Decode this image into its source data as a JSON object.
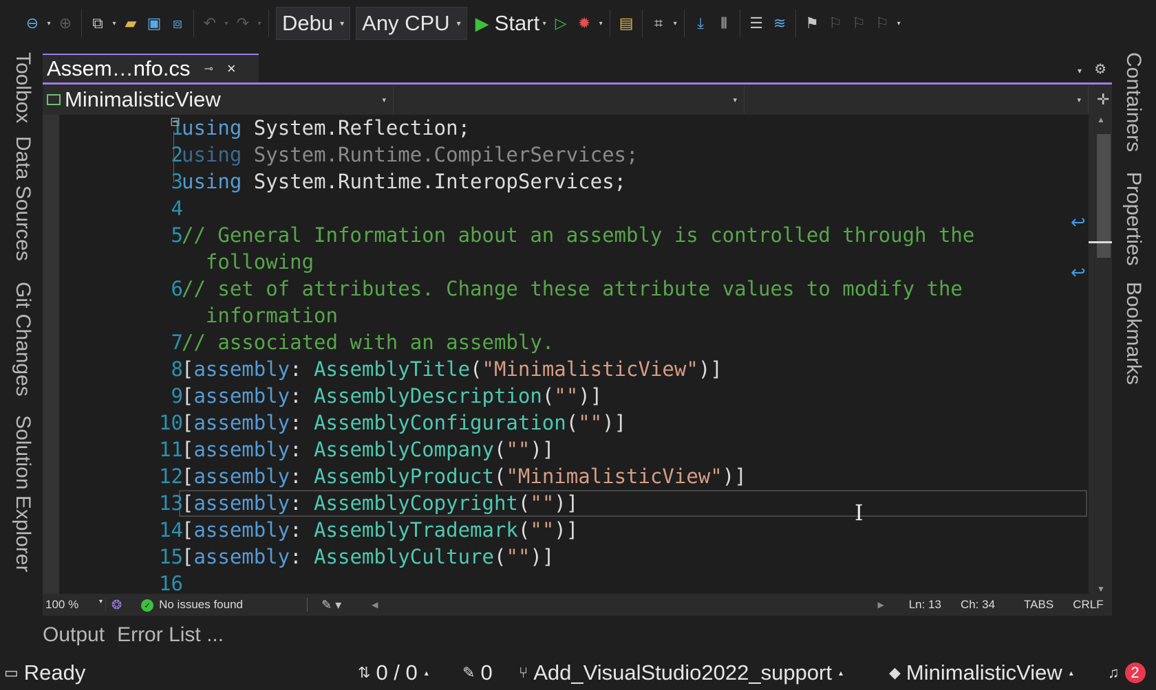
{
  "toolbar": {
    "config_label": "Debu",
    "platform_label": "Any CPU",
    "start_label": "Start"
  },
  "left_rail": [
    "Toolbox",
    "Data Sources",
    "Git Changes",
    "Solution Explorer"
  ],
  "right_rail": [
    "Containers",
    "Properties",
    "Bookmarks"
  ],
  "doc_tab": {
    "title": "Assem…nfo.cs"
  },
  "navbar": {
    "class_label": "MinimalisticView"
  },
  "editor": {
    "lines": [
      {
        "n": "1",
        "parts": [
          [
            "kw",
            "using"
          ],
          [
            "txt",
            " System.Reflection;"
          ]
        ]
      },
      {
        "n": "2",
        "parts": [
          [
            "kw-dim",
            "using"
          ],
          [
            "txt-dim",
            " System.Runtime.CompilerServices;"
          ]
        ]
      },
      {
        "n": "3",
        "parts": [
          [
            "kw",
            "using"
          ],
          [
            "txt",
            " System.Runtime.InteropServices;"
          ]
        ]
      },
      {
        "n": "4",
        "parts": []
      },
      {
        "n": "5",
        "parts": [
          [
            "cmt",
            "// General Information about an assembly is controlled through the"
          ]
        ]
      },
      {
        "n": "",
        "parts": [
          [
            "cmt",
            "  following"
          ]
        ]
      },
      {
        "n": "6",
        "parts": [
          [
            "cmt",
            "// set of attributes. Change these attribute values to modify the"
          ]
        ]
      },
      {
        "n": "",
        "parts": [
          [
            "cmt",
            "  information"
          ]
        ]
      },
      {
        "n": "7",
        "parts": [
          [
            "cmt",
            "// associated with an assembly."
          ]
        ]
      },
      {
        "n": "8",
        "parts": [
          [
            "txt",
            "["
          ],
          [
            "attr-kw",
            "assembly"
          ],
          [
            "txt",
            ": "
          ],
          [
            "typ",
            "AssemblyTitle"
          ],
          [
            "txt",
            "("
          ],
          [
            "str",
            "\"MinimalisticView\""
          ],
          [
            "txt",
            ")]"
          ]
        ]
      },
      {
        "n": "9",
        "parts": [
          [
            "txt",
            "["
          ],
          [
            "attr-kw",
            "assembly"
          ],
          [
            "txt",
            ": "
          ],
          [
            "typ",
            "AssemblyDescription"
          ],
          [
            "txt",
            "("
          ],
          [
            "str",
            "\"\""
          ],
          [
            "txt",
            ")]"
          ]
        ]
      },
      {
        "n": "10",
        "parts": [
          [
            "txt",
            "["
          ],
          [
            "attr-kw",
            "assembly"
          ],
          [
            "txt",
            ": "
          ],
          [
            "typ",
            "AssemblyConfiguration"
          ],
          [
            "txt",
            "("
          ],
          [
            "str",
            "\"\""
          ],
          [
            "txt",
            ")]"
          ]
        ]
      },
      {
        "n": "11",
        "parts": [
          [
            "txt",
            "["
          ],
          [
            "attr-kw",
            "assembly"
          ],
          [
            "txt",
            ": "
          ],
          [
            "typ",
            "AssemblyCompany"
          ],
          [
            "txt",
            "("
          ],
          [
            "str",
            "\"\""
          ],
          [
            "txt",
            ")]"
          ]
        ]
      },
      {
        "n": "12",
        "parts": [
          [
            "txt",
            "["
          ],
          [
            "attr-kw",
            "assembly"
          ],
          [
            "txt",
            ": "
          ],
          [
            "typ",
            "AssemblyProduct"
          ],
          [
            "txt",
            "("
          ],
          [
            "str",
            "\"MinimalisticView\""
          ],
          [
            "txt",
            ")]"
          ]
        ]
      },
      {
        "n": "13",
        "parts": [
          [
            "txt",
            "["
          ],
          [
            "attr-kw",
            "assembly"
          ],
          [
            "txt",
            ": "
          ],
          [
            "typ",
            "AssemblyCopyright"
          ],
          [
            "txt",
            "("
          ],
          [
            "str",
            "\"\""
          ],
          [
            "txt",
            ")]"
          ]
        ]
      },
      {
        "n": "14",
        "parts": [
          [
            "txt",
            "["
          ],
          [
            "attr-kw",
            "assembly"
          ],
          [
            "txt",
            ": "
          ],
          [
            "typ",
            "AssemblyTrademark"
          ],
          [
            "txt",
            "("
          ],
          [
            "str",
            "\"\""
          ],
          [
            "txt",
            ")]"
          ]
        ]
      },
      {
        "n": "15",
        "parts": [
          [
            "txt",
            "["
          ],
          [
            "attr-kw",
            "assembly"
          ],
          [
            "txt",
            ": "
          ],
          [
            "typ",
            "AssemblyCulture"
          ],
          [
            "txt",
            "("
          ],
          [
            "str",
            "\"\""
          ],
          [
            "txt",
            ")]"
          ]
        ]
      },
      {
        "n": "16",
        "parts": []
      }
    ],
    "current_line": "13"
  },
  "editor_status": {
    "zoom": "100 %",
    "issues": "No issues found",
    "line": "Ln: 13",
    "col": "Ch: 34",
    "indent": "TABS",
    "eol": "CRLF"
  },
  "bottom_tabs": {
    "output": "Output",
    "error_list": "Error List ..."
  },
  "statusbar": {
    "ready": "Ready",
    "sync": "0 / 0",
    "pending": "0",
    "branch": "Add_VisualStudio2022_support",
    "repo": "MinimalisticView",
    "notifications": "2"
  },
  "colors": {
    "accent": "#9b7fe6",
    "keyword": "#569cd6",
    "comment": "#57a64a",
    "type": "#4ec9b0",
    "string": "#d69d85",
    "line_number": "#2b91af"
  }
}
